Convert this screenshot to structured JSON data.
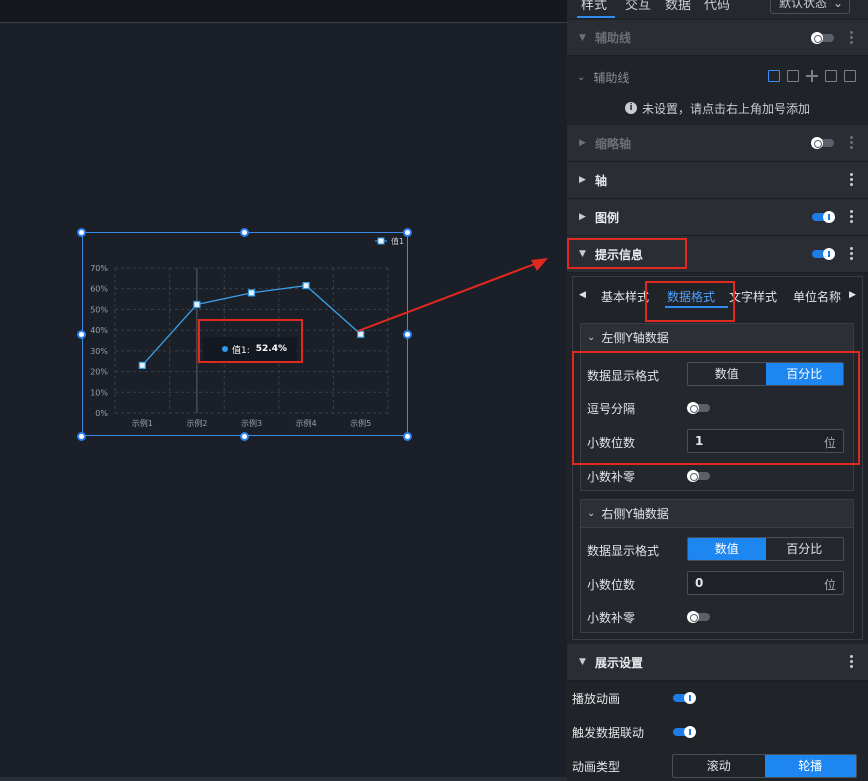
{
  "panel_tabs": {
    "style": "样式",
    "interaction": "交互",
    "data": "数据",
    "code": "代码",
    "state": "默认状态"
  },
  "sections": {
    "guide_line": "辅助线",
    "zoom_axis": "缩略轴",
    "axis": "轴",
    "legend": "图例",
    "tooltip": "提示信息",
    "display": "展示设置"
  },
  "guide_sub": {
    "title": "辅助线",
    "empty_hint": "未设置，请点击右上角加号添加"
  },
  "tooltip_tabs": [
    "基本样式",
    "数据格式",
    "文字样式",
    "单位名称"
  ],
  "left_y": {
    "title": "左侧Y轴数据",
    "format_label": "数据显示格式",
    "opt_value": "数值",
    "opt_percent": "百分比",
    "comma_label": "逗号分隔",
    "decimal_label": "小数位数",
    "decimal_value": "1",
    "unit": "位",
    "pad_label": "小数补零"
  },
  "right_y": {
    "title": "右侧Y轴数据",
    "format_label": "数据显示格式",
    "opt_value": "数值",
    "opt_percent": "百分比",
    "decimal_label": "小数位数",
    "decimal_value": "0",
    "unit": "位",
    "pad_label": "小数补零"
  },
  "display": {
    "play_anim": "播放动画",
    "trigger_link": "触发数据联动",
    "anim_type": "动画类型",
    "opt_scroll": "滚动",
    "opt_carousel": "轮播"
  },
  "tooltip_popup": {
    "label": "值1:",
    "value": "52.4%"
  },
  "chart_data": {
    "type": "line",
    "categories": [
      "示例1",
      "示例2",
      "示例3",
      "示例4",
      "示例5"
    ],
    "series": [
      {
        "name": "值1",
        "values": [
          23,
          52.4,
          58,
          61.5,
          38
        ]
      }
    ],
    "y_ticks": [
      "0%",
      "10%",
      "20%",
      "30%",
      "40%",
      "50%",
      "60%",
      "70%"
    ],
    "ylim": [
      0,
      70
    ],
    "grid": true,
    "legend": "top-right",
    "color": "#3aa0e8"
  }
}
